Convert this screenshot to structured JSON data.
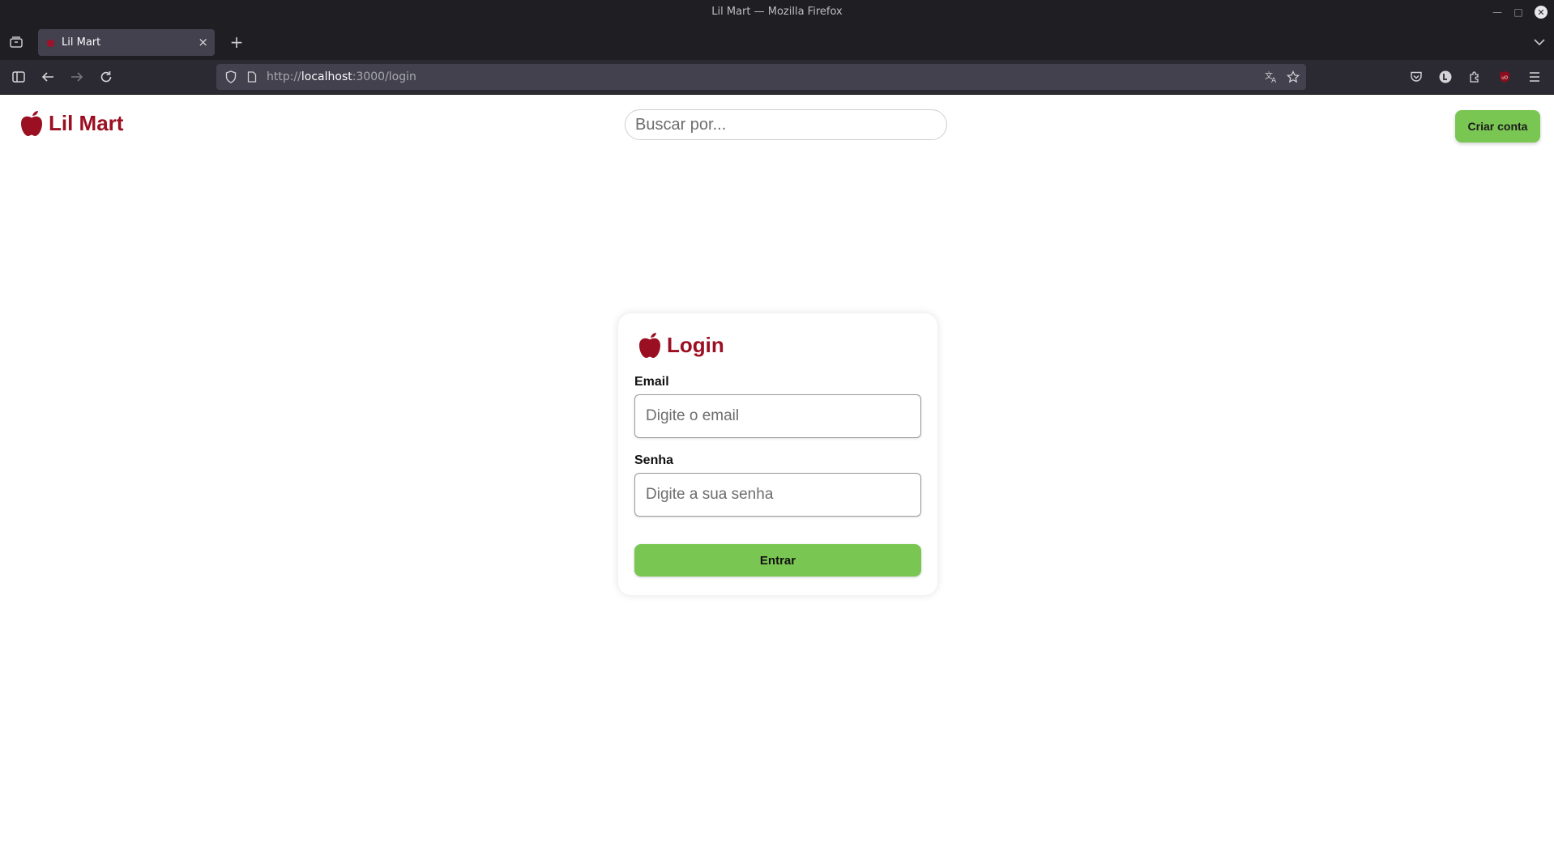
{
  "window": {
    "title": "Lil Mart — Mozilla Firefox"
  },
  "tab": {
    "label": "Lil Mart",
    "close_glyph": "×",
    "new_tab_glyph": "+"
  },
  "address_bar": {
    "url_prefix": "http://",
    "url_host": "localhost",
    "url_rest": ":3000/login"
  },
  "header": {
    "brand": "Lil Mart",
    "search_placeholder": "Buscar por...",
    "signup_label": "Criar conta"
  },
  "login": {
    "title": "Login",
    "email_label": "Email",
    "email_placeholder": "Digite o email",
    "email_value": "",
    "password_label": "Senha",
    "password_placeholder": "Digite a sua senha",
    "password_value": "",
    "submit_label": "Entrar"
  },
  "colors": {
    "brand_red": "#9b0f22",
    "button_green": "#7ac653",
    "chrome_dark": "#1f1f23",
    "urlbar": "#42414d"
  },
  "icons": [
    "apple-logo-icon",
    "tab-overview-icon",
    "sidebar-icon",
    "back-icon",
    "forward-icon",
    "reload-icon",
    "shield-icon",
    "page-icon",
    "translate-icon",
    "bookmark-star-icon",
    "pocket-icon",
    "account-icon",
    "extensions-icon",
    "ublock-icon",
    "menu-icon",
    "tab-list-icon",
    "minimize-icon",
    "maximize-icon",
    "close-window-icon"
  ]
}
